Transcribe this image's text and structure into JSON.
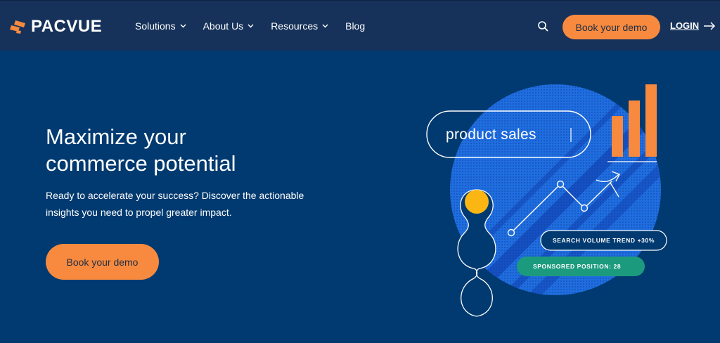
{
  "brand": {
    "name": "PACVUE",
    "colors": {
      "navy": "#003a70",
      "nav_bg": "#16325a",
      "orange": "#f78a3f",
      "yellow": "#fbb614",
      "green": "#1c9a7e",
      "blue": "#1f6ee0"
    }
  },
  "nav": {
    "items": [
      {
        "label": "Solutions",
        "has_dropdown": true
      },
      {
        "label": "About Us",
        "has_dropdown": true
      },
      {
        "label": "Resources",
        "has_dropdown": true
      },
      {
        "label": "Blog",
        "has_dropdown": false
      }
    ],
    "search_icon": "search-icon",
    "cta_label": "Book your demo",
    "login_label": "LOGIN"
  },
  "hero": {
    "title_line1": "Maximize your",
    "title_line2": "commerce potential",
    "subtitle_line1": "Ready to accelerate your success? Discover the actionable",
    "subtitle_line2": "insights you need to propel greater impact.",
    "cta_label": "Book your demo"
  },
  "illustration": {
    "search_pill_text": "product sales",
    "trend_badge": "SEARCH VOLUME TREND +30%",
    "position_badge": "SPONSORED POSITION: 28"
  }
}
